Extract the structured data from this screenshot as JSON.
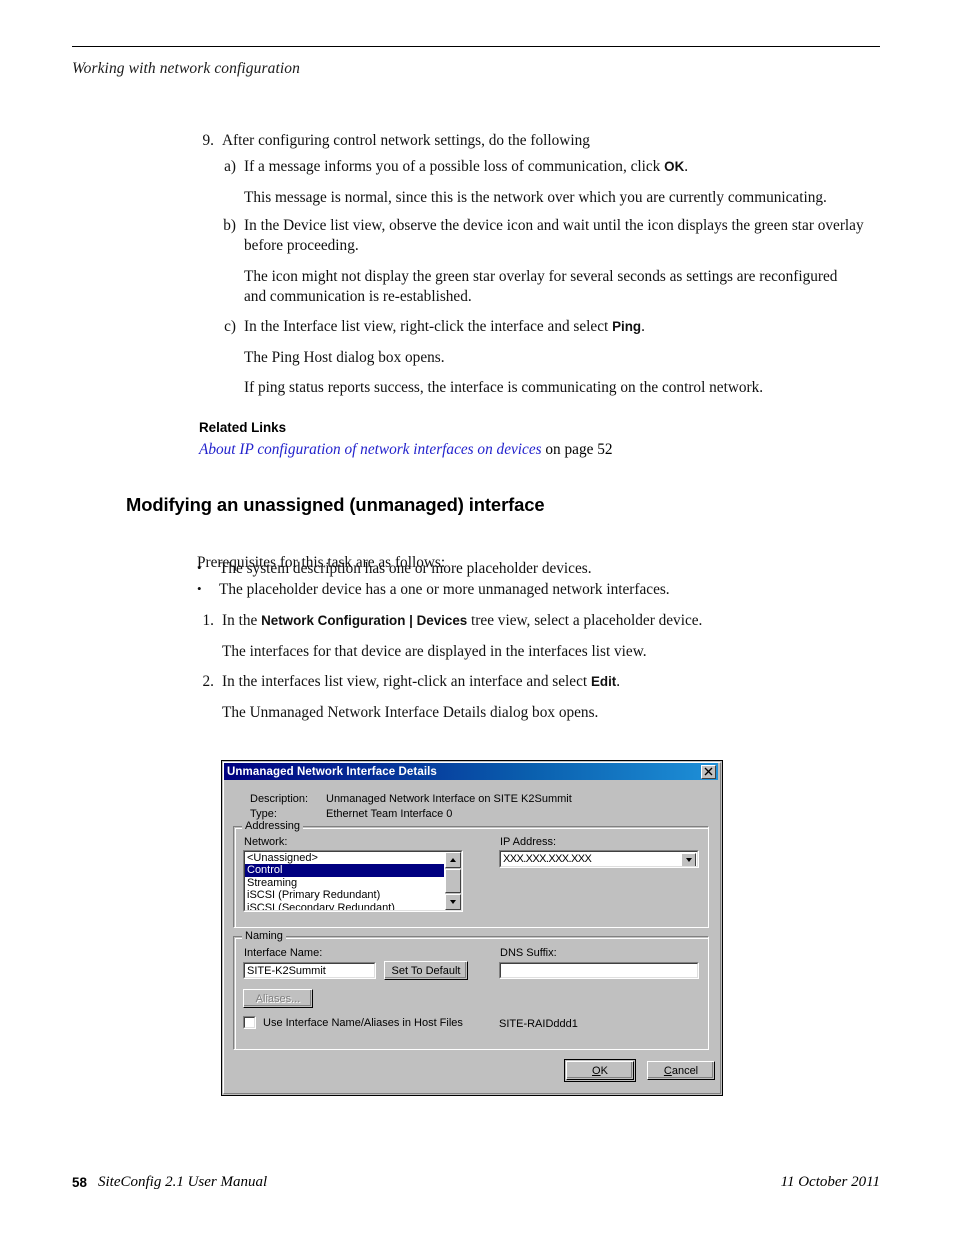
{
  "header": {
    "running_head": "Working with network configuration"
  },
  "step9": {
    "number": "9.",
    "text": "After configuring control network settings, do the following",
    "sub_a": {
      "marker": "a)",
      "text_before": "If a message informs you of a possible loss of communication, click ",
      "ui_term": "OK",
      "text_after": ".",
      "note": "This message is normal, since this is the network over which you are currently communicating."
    },
    "sub_b": {
      "marker": "b)",
      "text": "In the Device list view, observe the device icon and wait until the icon displays the green star overlay before proceeding.",
      "note": "The icon might not display the green star overlay for several seconds as settings are reconfigured and communication is re-established."
    },
    "sub_c": {
      "marker": "c)",
      "text_before": "In the Interface list view, right-click the interface and select ",
      "ui_term": "Ping",
      "text_after": ".",
      "note1": "The Ping Host dialog box opens.",
      "note2": "If ping status reports success, the interface is communicating on the control network."
    }
  },
  "related_links": {
    "title": "Related Links",
    "link_text": "About IP configuration of network interfaces on devices",
    "link_suffix": " on page 52",
    "link_color": "#2222cc"
  },
  "section": {
    "heading": "Modifying an unassigned (unmanaged) interface",
    "intro": "Prerequisites for this task are as follows:",
    "bullets": [
      "The system description has one or more placeholder devices.",
      "The placeholder device has a one or more unmanaged network interfaces."
    ],
    "steps": [
      {
        "marker": "1.",
        "text_before": "In the ",
        "ui_term": "Network Configuration | Devices",
        "text_after": " tree view, select a placeholder device.",
        "note": "The interfaces for that device are displayed in the interfaces list view."
      },
      {
        "marker": "2.",
        "text_before": "In the interfaces list view, right-click an interface and select ",
        "ui_term": "Edit",
        "text_after": ".",
        "note": "The Unmanaged Network Interface Details dialog box opens."
      }
    ]
  },
  "dialog": {
    "title": "Unmanaged Network Interface Details",
    "close_glyph": "✕",
    "titlebar_color_left": "#000080",
    "titlebar_color_right": "#1e90d8",
    "face_color": "#c0c0c0",
    "description_label": "Description:",
    "description_value": "Unmanaged Network Interface on SITE K2Summit",
    "type_label": "Type:",
    "type_value": "Ethernet Team Interface 0",
    "addressing": {
      "legend": "Addressing",
      "network_label": "Network:",
      "network_items": [
        "<Unassigned>",
        "Control",
        "Streaming",
        "iSCSI (Primary Redundant)",
        "iSCSI (Secondary Redundant)"
      ],
      "network_selected_index": 1,
      "ip_label": "IP Address:",
      "ip_value": "XXX.XXX.XXX.XXX"
    },
    "naming": {
      "legend": "Naming",
      "interface_name_label": "Interface Name:",
      "interface_name_value": "SITE-K2Summit",
      "set_default_button": "Set To Default",
      "aliases_button": "Aliases...",
      "dns_suffix_label": "DNS Suffix:",
      "dns_suffix_value": "",
      "use_host_files_label": "Use Interface Name/Aliases in Host Files",
      "use_host_files_checked": false,
      "host_name_text": "SITE-RAIDddd1"
    },
    "ok_button": "OK",
    "cancel_button": "Cancel"
  },
  "footer": {
    "page_number": "58",
    "manual_title": "SiteConfig 2.1 User Manual",
    "date": "11 October 2011"
  }
}
